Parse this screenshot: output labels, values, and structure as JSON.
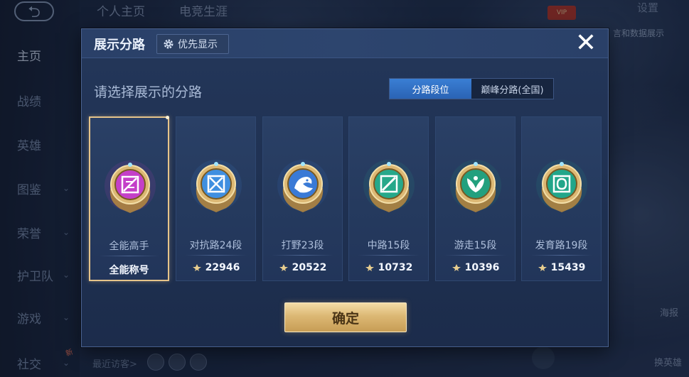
{
  "background": {
    "top_tabs": [
      "个人主页",
      "电竞生涯"
    ],
    "settings_label": "设置",
    "vip_label": "VIP",
    "right_top_text": "言和数据展示",
    "right_haibao_label": "海报",
    "right_hero_label": "换英雄",
    "recent_visitors_label": "最近访客>",
    "nav_items": [
      {
        "label": "主页",
        "active": true,
        "chevron": false
      },
      {
        "label": "战绩",
        "active": false,
        "chevron": false
      },
      {
        "label": "英雄",
        "active": false,
        "chevron": false
      },
      {
        "label": "图鉴",
        "active": false,
        "chevron": true
      },
      {
        "label": "荣誉",
        "active": false,
        "chevron": true
      },
      {
        "label": "护卫队",
        "active": false,
        "chevron": true
      },
      {
        "label": "游戏",
        "active": false,
        "chevron": true
      },
      {
        "label": "社交",
        "active": false,
        "chevron": true
      }
    ],
    "new_badge": "新"
  },
  "dialog": {
    "title": "展示分路",
    "priority_button": "优先显示",
    "close_glyph": "✕",
    "subtitle": "请选择展示的分路",
    "toggle": [
      {
        "label": "分路段位",
        "active": true
      },
      {
        "label": "巅峰分路(全国)",
        "active": false
      }
    ],
    "cards": [
      {
        "name": "全能高手",
        "score": "全能称号",
        "selected": true,
        "emblem": "allround-emblem-icon",
        "color": "#c43fc8",
        "show_rank_icon": false
      },
      {
        "name": "对抗路24段",
        "score": "22946",
        "selected": false,
        "emblem": "clash-lane-emblem-icon",
        "color": "#3f8fe0",
        "show_rank_icon": true
      },
      {
        "name": "打野23段",
        "score": "20522",
        "selected": false,
        "emblem": "jungle-emblem-icon",
        "color": "#3a7ad6",
        "show_rank_icon": true
      },
      {
        "name": "中路15段",
        "score": "10732",
        "selected": false,
        "emblem": "mid-lane-emblem-icon",
        "color": "#26a88a",
        "show_rank_icon": true
      },
      {
        "name": "游走15段",
        "score": "10396",
        "selected": false,
        "emblem": "roam-emblem-icon",
        "color": "#23a07e",
        "show_rank_icon": true
      },
      {
        "name": "发育路19段",
        "score": "15439",
        "selected": false,
        "emblem": "farm-lane-emblem-icon",
        "color": "#22a68a",
        "show_rank_icon": true
      }
    ],
    "confirm_label": "确定"
  },
  "colors": {
    "gold": "#dcb874",
    "accent_blue": "#2f6fc4",
    "panel": "#22355a"
  }
}
